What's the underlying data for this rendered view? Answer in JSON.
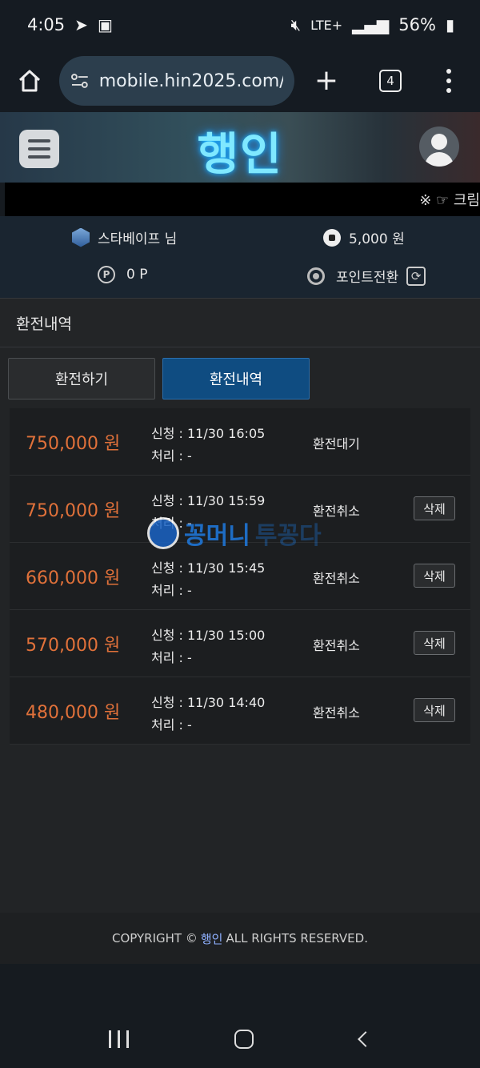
{
  "status_bar": {
    "time": "4:05",
    "network": "LTE+",
    "battery": "56%"
  },
  "browser": {
    "url": "mobile.hin2025.com/",
    "tab_count": "4"
  },
  "site": {
    "logo": "행인",
    "ticker": "※ ☞ 크림"
  },
  "user": {
    "name": "스타베이프 님",
    "money": "5,000 원",
    "points": "0 P",
    "point_convert": "포인트전환"
  },
  "panel": {
    "title": "환전내역",
    "tabs": [
      {
        "label": "환전하기",
        "active": false
      },
      {
        "label": "환전내역",
        "active": true
      }
    ]
  },
  "rows": [
    {
      "amount": "750,000 원",
      "request": "신청 : 11/30 16:05",
      "process": "처리 : -",
      "status": "환전대기",
      "delete": ""
    },
    {
      "amount": "750,000 원",
      "request": "신청 : 11/30 15:59",
      "process": "처리 : -",
      "status": "환전취소",
      "delete": "삭제"
    },
    {
      "amount": "660,000 원",
      "request": "신청 : 11/30 15:45",
      "process": "처리 : -",
      "status": "환전취소",
      "delete": "삭제"
    },
    {
      "amount": "570,000 원",
      "request": "신청 : 11/30 15:00",
      "process": "처리 : -",
      "status": "환전취소",
      "delete": "삭제"
    },
    {
      "amount": "480,000 원",
      "request": "신청 : 11/30 14:40",
      "process": "처리 : -",
      "status": "환전취소",
      "delete": "삭제"
    }
  ],
  "watermark": {
    "text": "꽁머니",
    "text2": "투꽁다"
  },
  "footer": {
    "prefix": "COPYRIGHT ©",
    "brand": "행인",
    "suffix": "ALL RIGHTS RESERVED."
  },
  "colors": {
    "amount": "#e0713a",
    "active_tab": "#0f4c81",
    "logo_glow": "#7fe8ff"
  }
}
